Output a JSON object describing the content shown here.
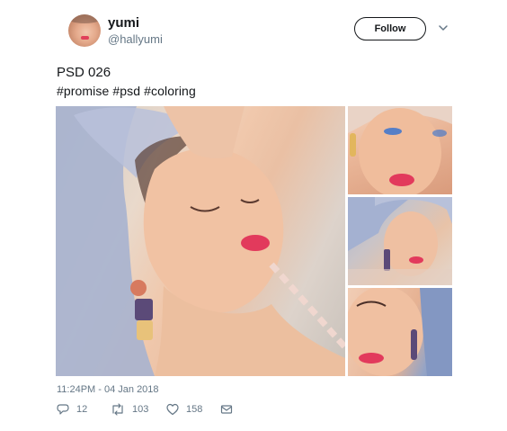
{
  "user": {
    "display_name": "yumi",
    "handle": "@hallyumi",
    "avatar_icon": "profile-photo"
  },
  "header": {
    "follow_label": "Follow",
    "more_icon": "chevron-down-icon"
  },
  "tweet": {
    "title": "PSD 026",
    "hashtags": "#promise #psd #coloring",
    "timestamp": "11:24PM - 04 Jan 2018"
  },
  "media": {
    "photos": [
      {
        "name": "main",
        "subject": "woman with towel turban and red lips"
      },
      {
        "name": "top",
        "subject": "close-up with blue eyeshadow"
      },
      {
        "name": "middle",
        "subject": "woman with towel turban"
      },
      {
        "name": "bottom",
        "subject": "portrait with blue towel"
      }
    ]
  },
  "actions": {
    "reply_count": "12",
    "retweet_count": "103",
    "like_count": "158"
  },
  "colors": {
    "text": "#14171a",
    "muted": "#657786",
    "lip": "#e23a5c"
  }
}
